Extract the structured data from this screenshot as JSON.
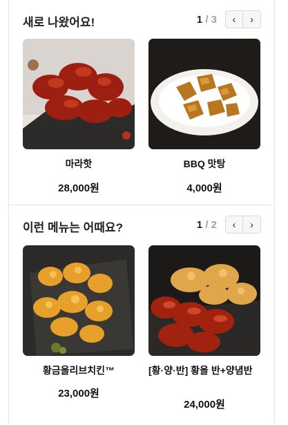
{
  "sections": [
    {
      "title": "새로 나왔어요!",
      "pager": {
        "current": "1",
        "separator": "/",
        "total": "3",
        "prev_icon": "chevron-left-icon",
        "next_icon": "chevron-right-icon"
      },
      "items": [
        {
          "name": "마라핫",
          "price": "28,000원"
        },
        {
          "name": "BBQ 맛탕",
          "price": "4,000원"
        }
      ]
    },
    {
      "title": "이런 메뉴는 어때요?",
      "pager": {
        "current": "1",
        "separator": "/",
        "total": "2",
        "prev_icon": "chevron-left-icon",
        "next_icon": "chevron-right-icon"
      },
      "items": [
        {
          "name": "황금올리브치킨™",
          "price": "23,000원"
        },
        {
          "name": "[황·양·반] 황올 반+양념반",
          "price": "24,000원"
        }
      ]
    }
  ]
}
